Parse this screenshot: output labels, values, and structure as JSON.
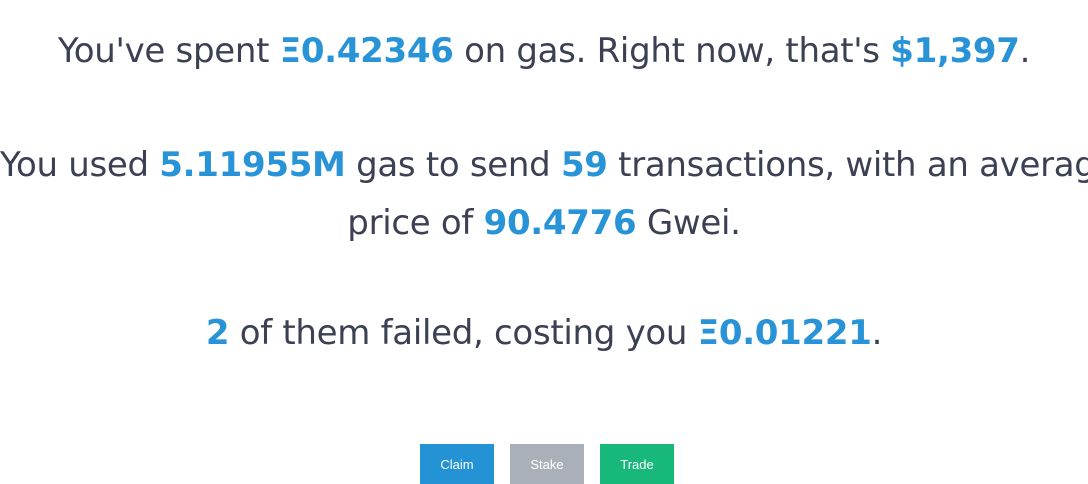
{
  "spent": {
    "prefix": "You've spent ",
    "eth_amount": "Ξ0.42346",
    "middle": " on gas. Right now, that's ",
    "usd_amount": "$1,397",
    "suffix": "."
  },
  "usage": {
    "prefix": "You used ",
    "gas_amount": "5.11955M",
    "middle1": " gas to send ",
    "tx_count": "59",
    "middle2": " transactions, with an average",
    "line2_prefix": "price of ",
    "avg_price": "90.4776",
    "line2_suffix": " Gwei."
  },
  "failed": {
    "count": "2",
    "middle": " of them failed, costing you ",
    "eth_amount": "Ξ0.01221",
    "suffix": "."
  },
  "buttons": {
    "claim": "Claim",
    "stake": "Stake",
    "trade": "Trade"
  },
  "colors": {
    "highlight": "#2893d6",
    "text": "#3b4053",
    "claim": "#2493d6",
    "stake": "#a9b0ba",
    "trade": "#17b87a"
  }
}
